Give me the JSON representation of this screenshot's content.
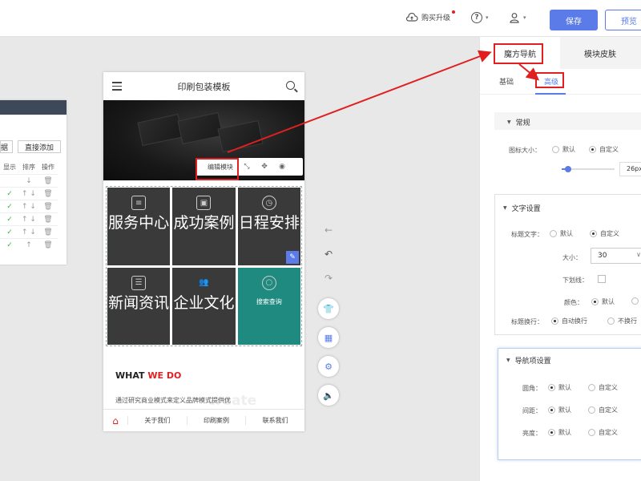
{
  "topbar": {
    "buy_label": "购买升级",
    "save_label": "保存",
    "preview_label": "预览"
  },
  "left_panel": {
    "btn_left": "据",
    "btn_add": "直接添加",
    "headers": [
      "显示",
      "排序",
      "操作"
    ],
    "rows": [
      {
        "show": "",
        "sort": "↓",
        "op": "🗑"
      },
      {
        "show": "✓",
        "sort": "↑ ↓",
        "op": "🗑"
      },
      {
        "show": "✓",
        "sort": "↑ ↓",
        "op": "🗑"
      },
      {
        "show": "✓",
        "sort": "↑ ↓",
        "op": "🗑"
      },
      {
        "show": "✓",
        "sort": "↑ ↓",
        "op": "🗑"
      },
      {
        "show": "✓",
        "sort": "↑",
        "op": "🗑"
      }
    ]
  },
  "phone": {
    "title": "印刷包装模板",
    "edit_module": "编辑模块",
    "tiles": [
      {
        "label": "服务中心",
        "icon": "list-icon"
      },
      {
        "label": "成功案例",
        "icon": "image-icon"
      },
      {
        "label": "日程安排",
        "icon": "clock-icon"
      },
      {
        "label": "新闻资讯",
        "icon": "document-icon"
      },
      {
        "label": "企业文化",
        "icon": "people-icon"
      },
      {
        "label": "搜索查询",
        "icon": "search-icon"
      }
    ],
    "what_we_black": "WHAT",
    "what_we_red": "WE DO",
    "description": "通过研究商业模式来定义品牌模式提供优",
    "watermark": "create",
    "footer": [
      "关于我们",
      "印刷案例",
      "联系我们"
    ]
  },
  "right_panel": {
    "tabs": [
      "魔方导航",
      "模块皮肤"
    ],
    "subtabs": [
      "基础",
      "高级"
    ],
    "section_general": {
      "title": "常规",
      "icon_size_label": "图标大小：",
      "default": "默认",
      "custom": "自定义",
      "slider_value": "26px"
    },
    "section_text": {
      "title": "文字设置",
      "title_text_label": "标题文字：",
      "default": "默认",
      "custom": "自定义",
      "size_label": "大小：",
      "size_value": "30",
      "underline_label": "下划线：",
      "color_label": "颜色：",
      "color_default": "默认",
      "wrap_label": "标题换行：",
      "auto_wrap": "自动换行",
      "no_wrap": "不换行"
    },
    "section_nav": {
      "title": "导航项设置",
      "radius_label": "圆角：",
      "gap_label": "间距：",
      "brightness_label": "亮度：",
      "default": "默认",
      "custom": "自定义"
    }
  },
  "colors": {
    "primary": "#5a7be8",
    "teal_tile": "#1f8a80",
    "dark_tile": "#3a3a3a",
    "highlight_red": "#e02020"
  }
}
